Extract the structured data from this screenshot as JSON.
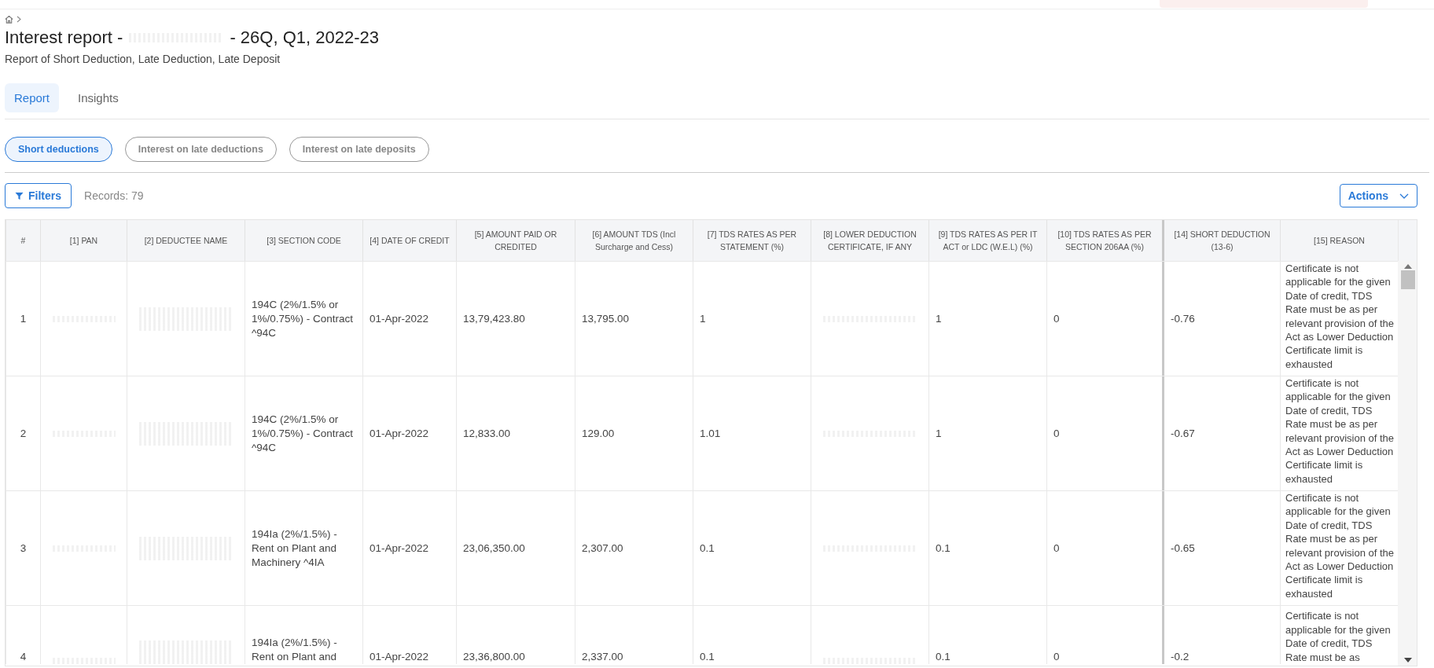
{
  "header": {
    "title_prefix": "Interest report -",
    "title_suffix": "- 26Q, Q1, 2022-23",
    "subtitle": "Report of Short Deduction, Late Deduction, Late Deposit"
  },
  "tabs": [
    {
      "label": "Report",
      "selected": true
    },
    {
      "label": "Insights",
      "selected": false
    }
  ],
  "report_types": [
    {
      "label": "Short deductions",
      "selected": true
    },
    {
      "label": "Interest on late deductions",
      "selected": false
    },
    {
      "label": "Interest on late deposits",
      "selected": false
    }
  ],
  "toolbar": {
    "filters_button": "Filters",
    "records": "Records: 79",
    "actions_button": "Actions"
  },
  "table": {
    "columns": [
      {
        "label": "#",
        "pinned": false
      },
      {
        "label": "[1] PAN",
        "pinned": false
      },
      {
        "label": "[2] DEDUCTEE NAME",
        "pinned": false
      },
      {
        "label": "[3] SECTION CODE",
        "pinned": false
      },
      {
        "label": "[4] DATE OF CREDIT",
        "pinned": false
      },
      {
        "label": "[5] AMOUNT PAID OR CREDITED",
        "pinned": false
      },
      {
        "label": "[6] AMOUNT TDS (Incl Surcharge and Cess)",
        "pinned": false
      },
      {
        "label": "[7] TDS RATES AS PER STATEMENT (%)",
        "pinned": false
      },
      {
        "label": "[8] LOWER DEDUCTION CERTIFICATE, IF ANY",
        "pinned": false
      },
      {
        "label": "[9] TDS RATES AS PER IT ACT or LDC (W.E.L) (%)",
        "pinned": false
      },
      {
        "label": "[10] TDS RATES AS PER SECTION 206AA (%)",
        "pinned": false
      },
      {
        "label": "[14] SHORT DEDUCTION (13-6)",
        "pinned": true
      },
      {
        "label": "[15] REASON",
        "pinned": false
      }
    ],
    "rows": [
      {
        "cells": [
          {
            "kind": "text",
            "text": "1"
          },
          {
            "kind": "redacted"
          },
          {
            "kind": "redacted"
          },
          {
            "kind": "text",
            "text": "194C (2%/1.5% or 1%/0.75%) - Contract ^94C"
          },
          {
            "kind": "text",
            "text": "01-Apr-2022"
          },
          {
            "kind": "text",
            "text": "13,79,423.80"
          },
          {
            "kind": "text",
            "text": "13,795.00"
          },
          {
            "kind": "text",
            "text": "1"
          },
          {
            "kind": "redacted"
          },
          {
            "kind": "text",
            "text": "1"
          },
          {
            "kind": "text",
            "text": "0"
          },
          {
            "kind": "text",
            "text": "-0.76"
          },
          {
            "kind": "text",
            "text": "Certificate is not applicable for the given Date of credit, TDS Rate must be as per relevant provision of the Act as Lower Deduction Certificate limit is exhausted"
          }
        ]
      },
      {
        "cells": [
          {
            "kind": "text",
            "text": "2"
          },
          {
            "kind": "redacted"
          },
          {
            "kind": "redacted"
          },
          {
            "kind": "text",
            "text": "194C (2%/1.5% or 1%/0.75%) - Contract ^94C"
          },
          {
            "kind": "text",
            "text": "01-Apr-2022"
          },
          {
            "kind": "text",
            "text": "12,833.00"
          },
          {
            "kind": "text",
            "text": "129.00"
          },
          {
            "kind": "text",
            "text": "1.01"
          },
          {
            "kind": "redacted"
          },
          {
            "kind": "text",
            "text": "1"
          },
          {
            "kind": "text",
            "text": "0"
          },
          {
            "kind": "text",
            "text": "-0.67"
          },
          {
            "kind": "text",
            "text": "Certificate is not applicable for the given Date of credit, TDS Rate must be as per relevant provision of the Act as Lower Deduction Certificate limit is exhausted"
          }
        ]
      },
      {
        "cells": [
          {
            "kind": "text",
            "text": "3"
          },
          {
            "kind": "redacted"
          },
          {
            "kind": "redacted"
          },
          {
            "kind": "text",
            "text": "194Ia (2%/1.5%) - Rent on Plant and Machinery ^4IA"
          },
          {
            "kind": "text",
            "text": "01-Apr-2022"
          },
          {
            "kind": "text",
            "text": "23,06,350.00"
          },
          {
            "kind": "text",
            "text": "2,307.00"
          },
          {
            "kind": "text",
            "text": "0.1"
          },
          {
            "kind": "redacted"
          },
          {
            "kind": "text",
            "text": "0.1"
          },
          {
            "kind": "text",
            "text": "0"
          },
          {
            "kind": "text",
            "text": "-0.65"
          },
          {
            "kind": "text",
            "text": "Certificate is not applicable for the given Date of credit, TDS Rate must be as per relevant provision of the Act as Lower Deduction Certificate limit is exhausted"
          }
        ]
      },
      {
        "cells": [
          {
            "kind": "text",
            "text": "4"
          },
          {
            "kind": "redacted"
          },
          {
            "kind": "redacted"
          },
          {
            "kind": "text",
            "text": "194Ia (2%/1.5%) - Rent on Plant and"
          },
          {
            "kind": "text",
            "text": "01-Apr-2022"
          },
          {
            "kind": "text",
            "text": "23,36,800.00"
          },
          {
            "kind": "text",
            "text": "2,337.00"
          },
          {
            "kind": "text",
            "text": "0.1"
          },
          {
            "kind": "redacted"
          },
          {
            "kind": "text",
            "text": "0.1"
          },
          {
            "kind": "text",
            "text": "0"
          },
          {
            "kind": "text",
            "text": "-0.2"
          },
          {
            "kind": "text",
            "text": "Certificate is not applicable for the given Date of credit, TDS Rate must be as"
          }
        ]
      }
    ]
  }
}
